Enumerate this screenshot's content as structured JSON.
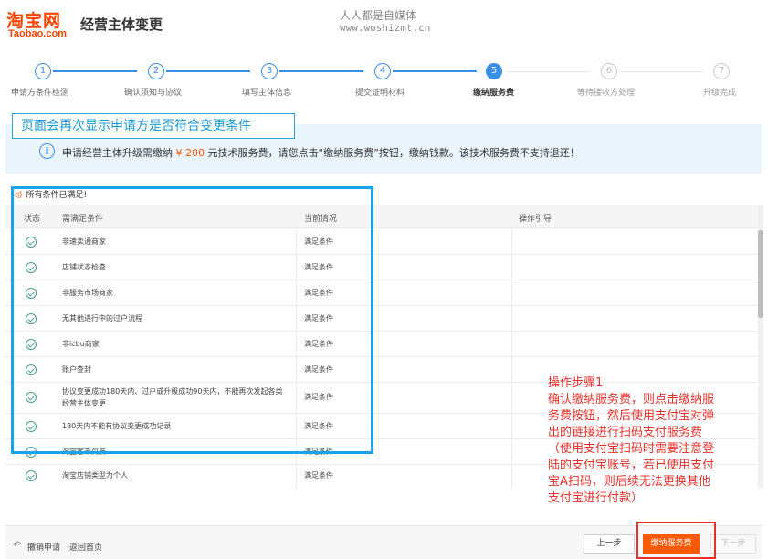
{
  "header": {
    "logo_cn": "淘宝网",
    "logo_en": "Taobao.com",
    "title": "经营主体变更",
    "watermark_line1": "人人都是自媒体",
    "watermark_line2": "www.woshizmt.cn"
  },
  "steps": [
    {
      "num": "1",
      "label": "申请方条件检测",
      "state": "done"
    },
    {
      "num": "2",
      "label": "确认须知与协议",
      "state": "done"
    },
    {
      "num": "3",
      "label": "填写主体信息",
      "state": "done"
    },
    {
      "num": "4",
      "label": "提交证明材料",
      "state": "done"
    },
    {
      "num": "5",
      "label": "缴纳服务费",
      "state": "active"
    },
    {
      "num": "6",
      "label": "等待接收方处理",
      "state": "todo"
    },
    {
      "num": "7",
      "label": "升级完成",
      "state": "todo"
    }
  ],
  "annotation_banner": "页面会再次显示申请方是否符合变更条件",
  "info": {
    "icon": "info-icon",
    "text_before": "申请经营主体升级需缴纳 ",
    "amount": "¥ 200",
    "text_after": " 元技术服务费，请您点击“缴纳服务费”按钮，缴纳钱款。该技术服务费不支持退还！"
  },
  "conditions_note": "所有条件已满足!",
  "table": {
    "headers": [
      "状态",
      "需满足条件",
      "当前情况",
      "操作引导"
    ],
    "rows": [
      {
        "condition": "非速卖通商家",
        "status": "满足条件"
      },
      {
        "condition": "店铺状态检查",
        "status": "满足条件"
      },
      {
        "condition": "非服务市场商家",
        "status": "满足条件"
      },
      {
        "condition": "无其他进行中的过户流程",
        "status": "满足条件"
      },
      {
        "condition": "非icbu商家",
        "status": "满足条件"
      },
      {
        "condition": "账户查封",
        "status": "满足条件"
      },
      {
        "condition_line1": "协议变更成功180天内、过户或升级成功90天内，不能再次发起各类",
        "condition_line2": "经营主体变更",
        "status": "满足条件"
      },
      {
        "condition": "180天内不能有协议变更成功记录",
        "status": "满足条件"
      },
      {
        "condition": "淘宝客未欠费",
        "status": "满足条件"
      },
      {
        "condition": "淘宝店铺类型为个人",
        "status": "满足条件"
      }
    ]
  },
  "red_note": [
    "操作步骤1",
    "确认缴纳服务费，则点击缴纳服",
    "务费按钮，然后使用支付宝对弹",
    "出的链接进行扫码支付服务费",
    "（使用支付宝扫码时需要注意登",
    "陆的支付宝账号，若已使用支付",
    "宝A扫码，则后续无法更换其他",
    "支付宝进行付款）"
  ],
  "bottom": {
    "undo_label": "撤销申请",
    "home_label": "返回首页",
    "prev_label": "上一步",
    "pay_label": "缴纳服务费",
    "next_label": "下一步"
  },
  "colors": {
    "brand": "#ff4400",
    "primary": "#3a8ee6",
    "pay_button": "#ff5a00",
    "annotation_red": "#e8312a",
    "annotation_blue": "#1aa3e8"
  }
}
